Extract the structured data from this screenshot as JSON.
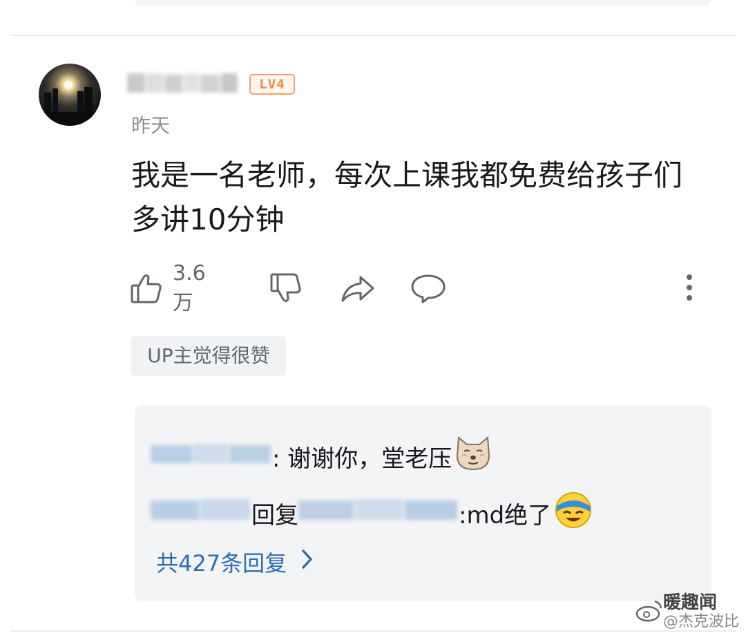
{
  "comment": {
    "username": "",
    "level": "LV4",
    "timestamp": "昨天",
    "text": "我是一名老师，每次上课我都免费给孩子们多讲10分钟",
    "like_count": "3.6万",
    "up_tag": "UP主觉得很赞"
  },
  "replies": {
    "items": [
      {
        "text": ": 谢谢你，堂老压",
        "emoji": "dog-face-emoji"
      },
      {
        "reply_word": "回复",
        "text": ":md绝了",
        "emoji": "laughing-crying-emoji"
      }
    ],
    "see_all_label": "共427条回复"
  },
  "watermark": {
    "line1": "暖趣闻",
    "line2": "@杰克波比"
  },
  "colors": {
    "level_badge": "#f08c4a",
    "link": "#2e6fb0",
    "muted": "#8c8f96",
    "reply_bg": "#f3f4f6"
  },
  "icons": [
    "like-icon",
    "dislike-icon",
    "share-icon",
    "reply-icon",
    "more-icon",
    "chevron-right-icon",
    "weibo-icon"
  ]
}
